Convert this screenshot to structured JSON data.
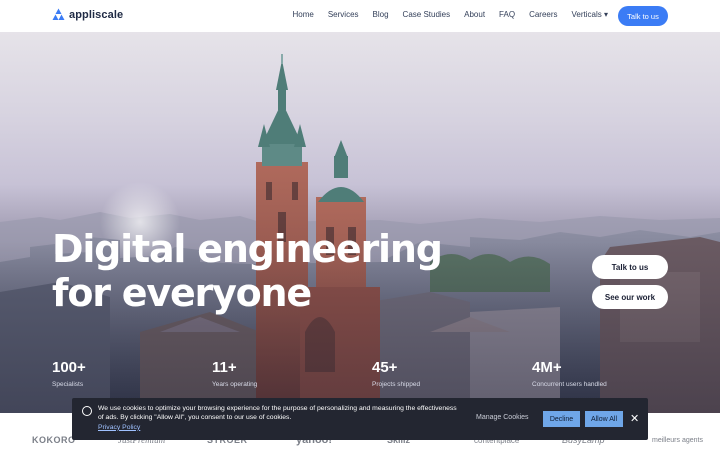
{
  "nav": {
    "brand": "appliscale",
    "items": [
      {
        "label": "Home"
      },
      {
        "label": "Services"
      },
      {
        "label": "Blog"
      },
      {
        "label": "Case Studies"
      },
      {
        "label": "About"
      },
      {
        "label": "FAQ"
      },
      {
        "label": "Careers"
      },
      {
        "label": "Verticals ▾"
      }
    ],
    "cta": "Talk to us",
    "accent": "#3b7cf5"
  },
  "hero": {
    "headline_line1": "Digital engineering",
    "headline_line2": "for everyone",
    "cta_primary": "Talk to us",
    "cta_secondary": "See our work"
  },
  "stats": [
    {
      "value": "100+",
      "label": "Specialists"
    },
    {
      "value": "11+",
      "label": "Years operating"
    },
    {
      "value": "45+",
      "label": "Projects shipped"
    },
    {
      "value": "4M+",
      "label": "Concurrent users handled"
    }
  ],
  "cookie": {
    "text": "We use cookies to optimize your browsing experience for the purpose of personalizing and measuring the effectiveness of ads. By clicking \"Allow All\", you consent to our use of cookies.",
    "policy": "Privacy Policy",
    "manage": "Manage Cookies",
    "decline": "Decline",
    "allow": "Allow All",
    "close": "✕"
  },
  "brands": [
    "KOKORO",
    "JustPremium",
    "STRÖER",
    "yahoo!",
    "Skillz",
    "contentplace",
    "BusyLamp",
    "meilleurs agents"
  ]
}
